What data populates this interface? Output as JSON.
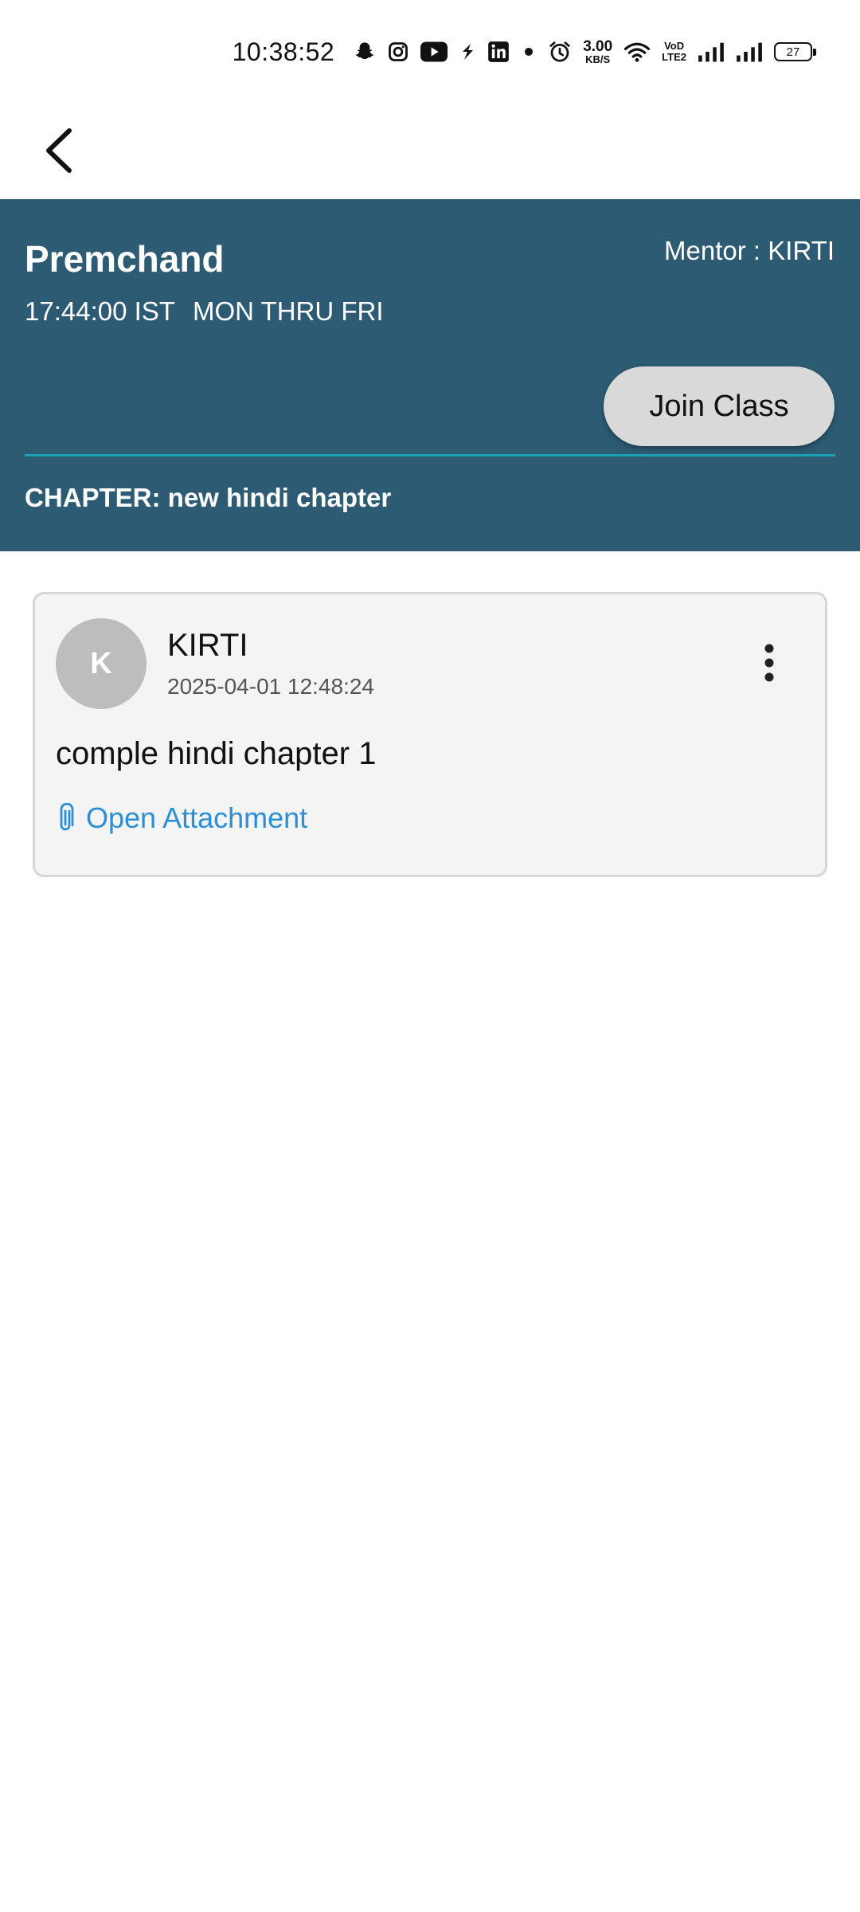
{
  "status_bar": {
    "time": "10:38:52",
    "network_speed_value": "3.00",
    "network_speed_unit": "KB/S",
    "volte_label_top": "VoD",
    "volte_label_bottom": "LTE2",
    "battery_level": "27",
    "icons": [
      "snapchat-icon",
      "instagram-icon",
      "youtube-icon",
      "app-icon",
      "linkedin-icon",
      "dot-icon",
      "alarm-icon",
      "wifi-icon",
      "signal-icon",
      "signal-icon",
      "battery-icon"
    ]
  },
  "app_bar": {
    "back_icon": "chevron-left-icon"
  },
  "class_info": {
    "title": "Premchand",
    "mentor": "Mentor : KIRTI",
    "time": "17:44:00 IST",
    "days": "MON THRU FRI",
    "join_label": "Join Class",
    "chapter": "CHAPTER: new hindi chapter",
    "colors": {
      "header_bg": "#2d5b73",
      "divider": "#1ba1b3",
      "join_bg": "#d9d9d9"
    }
  },
  "post": {
    "avatar_initial": "K",
    "author": "KIRTI",
    "timestamp": "2025-04-01 12:48:24",
    "content": "comple hindi chapter 1",
    "attachment_label": "Open Attachment",
    "attachment_icon": "paperclip-icon",
    "menu_icon": "more-vertical-icon",
    "colors": {
      "card_bg": "#f4f4f4",
      "link": "#2b8fd6",
      "avatar_bg": "#bdbdbd"
    }
  }
}
